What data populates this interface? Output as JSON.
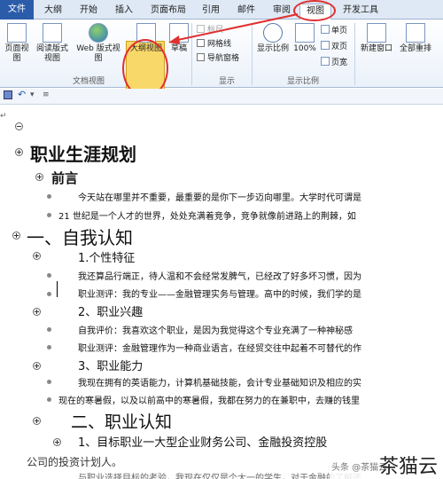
{
  "tabs": [
    {
      "label": "文件"
    },
    {
      "label": "大纲"
    },
    {
      "label": "开始"
    },
    {
      "label": "插入"
    },
    {
      "label": "页面布局"
    },
    {
      "label": "引用"
    },
    {
      "label": "邮件"
    },
    {
      "label": "审阅"
    },
    {
      "label": "视图"
    },
    {
      "label": "开发工具"
    }
  ],
  "ribbon": {
    "btn_page_view": "页面视图",
    "btn_read_view": "阅读版式视图",
    "btn_web_view": "Web 版式视图",
    "btn_outline_view": "大纲视图",
    "btn_draft": "草稿",
    "group_doc_views": "文档视图",
    "chk_ruler": "标尺",
    "chk_gridlines": "网格线",
    "chk_nav": "导航窗格",
    "group_show": "显示",
    "btn_zoom": "显示比例",
    "btn_100": "100%",
    "btn_one_page": "单页",
    "btn_two_pages": "双页",
    "btn_page_width": "页宽",
    "group_zoom": "显示比例",
    "btn_new_window": "新建窗口",
    "btn_arrange_all": "全部重排"
  },
  "qat": {
    "save_icon": "save-icon",
    "undo_icon": "undo-icon",
    "more": "▾"
  },
  "doc": {
    "title": "职业生涯规划",
    "preface": "前言",
    "p1": "今天站在哪里并不重要，最重要的是你下一步迈向哪里。大学时代可谓是",
    "p2": "21 世纪是一个人才的世界，处处充满着竞争，竞争就像前进路上的荆棘，如",
    "h1": "一、自我认知",
    "h1_1": "1.个性特征",
    "h1_1_p1": "我还算品行端正，待人温和不会经常发脾气，已经改了好多坏习惯，因为",
    "h1_1_p2": "职业测评：我的专业——金融管理实务与管理。高中的时候，我们学的是",
    "h1_2": "2、职业兴趣",
    "h1_2_p1": "自我评价：我喜欢这个职业，是因为我觉得这个专业充满了一种神秘感",
    "h1_2_p2": "职业测评：金融管理作为一种商业语言，在经贸交往中起着不可替代的作",
    "h1_3": "3、职业能力",
    "h1_3_p1": "我现在拥有的英语能力，计算机基础技能，会计专业基础知识及相应的实",
    "h1_3_p2": "现在的寒暑假，以及以前高中的寒暑假，我都在努力的在兼职中，去赚的钱里",
    "h2": "二、职业认知",
    "h2_1": "1、目标职业一大型企业财务公司、金融投资控股",
    "h2_1_p1": "公司的投资计划人。",
    "h2_1_p2": "与职业选择目标的考验，我现在仅仅是个大一的学生，对于金融的了解还"
  },
  "watermark": {
    "small": "头条 @茶猫云",
    "big": "茶猫云"
  }
}
